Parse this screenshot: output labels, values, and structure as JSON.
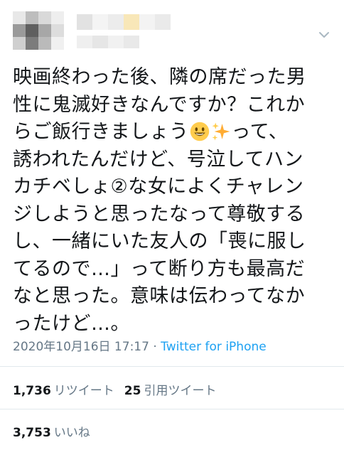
{
  "tweet": {
    "text_line1": "映画終わった後、隣の席だった男",
    "text_line2": "性に鬼滅好きなんですか？これか",
    "text_line3a": "らご飯行きましょう",
    "text_line3b": "って、",
    "text_line4": "誘われたんだけど、号泣してハン",
    "text_line5": "カチベしょ②な女によくチャレン",
    "text_line6": "ジしようと思ったなって尊敬する",
    "text_line7": "し、一緒にいた友人の「喪に服し",
    "text_line8": "てるので…」って断り方も最高だ",
    "text_line9": "なと思った。意味は伝わってなか",
    "text_line10": "ったけど…。",
    "emoji_1": "smiling-face-emoji",
    "emoji_2": "sparkles-emoji"
  },
  "meta": {
    "timestamp": "2020年10月16日 17:17",
    "separator": " · ",
    "source": "Twitter for iPhone"
  },
  "stats": {
    "retweets_count": "1,736",
    "retweets_label": "リツイート",
    "quotes_count": "25",
    "quotes_label": "引用ツイート",
    "likes_count": "3,753",
    "likes_label": "いいね"
  },
  "colors": {
    "text": "#14171a",
    "secondary": "#657786",
    "link": "#1da1f2",
    "divider": "#e1e8ed"
  },
  "icons": {
    "menu": "chevron-down-icon"
  }
}
